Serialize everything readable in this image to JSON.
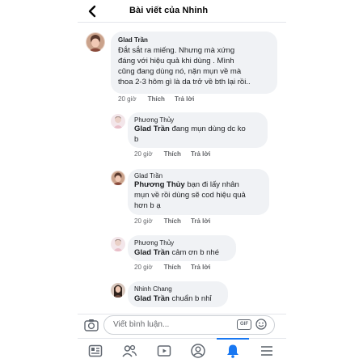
{
  "header": {
    "back_icon": "chevron-left-icon",
    "title": "Bài viết của Nhinh"
  },
  "comments": [
    {
      "author": "Glad Trần",
      "lines": [
        "Đắt sắt ra miếng. Nhưng mà xứng",
        "đáng với hiệu quả khi dùng . Mình",
        "cũng đang dùng nó, nặn mụn về mà",
        "thoa 2-3 hôm gì là da trở về bth lại rồi.."
      ],
      "time": "20 giờ",
      "like": "Thích",
      "reply": "Trả lời"
    },
    {
      "author": "Phương Thủy",
      "mention": "Glad Trần",
      "lines": [
        " đang mụn dùng dc ko",
        "b"
      ],
      "time": "20 giờ",
      "like": "Thích",
      "reply": "Trả lời"
    },
    {
      "author": "Glad Trần",
      "mention": "Phương Thủy",
      "lines": [
        " bạn đi lấy nhân",
        "mụn về rồi dùng sẽ cod hiệu quả",
        "hơn b ạ"
      ],
      "time": "20 giờ",
      "like": "Thích",
      "reply": "Trả lời"
    },
    {
      "author": "Phương Thủy",
      "mention": "Glad Trần",
      "lines": [
        " cảm ơn b nhé"
      ],
      "time": "20 giờ",
      "like": "Thích",
      "reply": "Trả lời"
    },
    {
      "author": "Nhinh Chang",
      "mention": "Glad Trần",
      "lines": [
        " chuẩn b nhỉ"
      ]
    }
  ],
  "composer": {
    "placeholder": "Viết bình luận...",
    "gif_label": "GIF",
    "camera_icon": "camera-icon",
    "emoji_icon": "emoji-icon"
  },
  "bottom_nav": [
    "news-feed-icon",
    "friends-icon",
    "watch-icon",
    "profile-icon",
    "notifications-icon",
    "menu-icon"
  ],
  "colors": {
    "accent": "#1877f2",
    "bubble": "#f0f2f5",
    "meta_text": "#65676b"
  }
}
